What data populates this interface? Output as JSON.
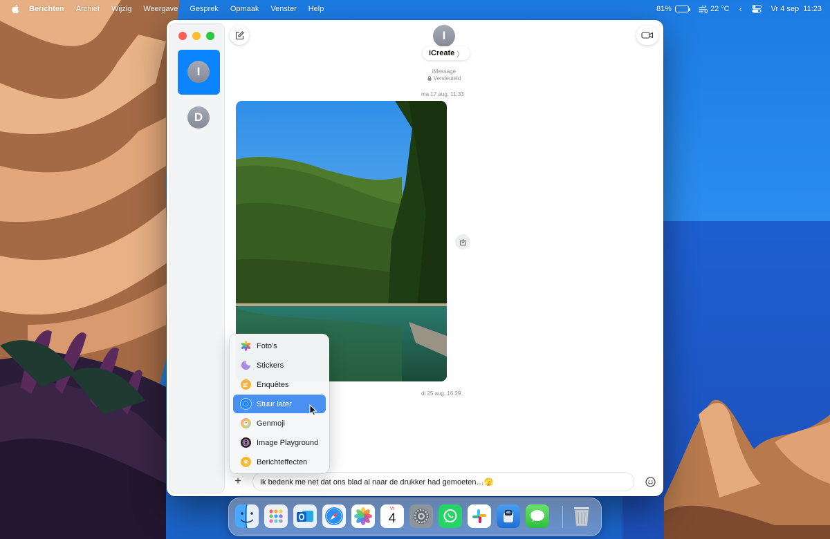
{
  "menubar": {
    "app_name": "Berichten",
    "menus": [
      "Archief",
      "Wijzig",
      "Weergave",
      "Gesprek",
      "Opmaak",
      "Venster",
      "Help"
    ],
    "battery_percent": "81%",
    "battery_level": 0.81,
    "temperature": "22 °C",
    "date_time": "Vr 4 sep  11:23"
  },
  "sidebar": {
    "conversations": [
      {
        "initial": "I",
        "selected": true
      },
      {
        "initial": "D",
        "selected": false
      }
    ]
  },
  "header": {
    "avatar_initial": "I",
    "contact_name": "iCreate",
    "chevron": "〉",
    "service": "iMessage",
    "encryption": "Versleuteld"
  },
  "messages": {
    "timestamp_1": "ma 17 aug, 11:33",
    "timestamp_2": "di 25 aug, 16:29"
  },
  "input": {
    "plus": "+",
    "text": "Ik bedenk me net dat ons blad al naar de drukker had gemoeten…🫣"
  },
  "popup_menu": {
    "items": [
      {
        "label": "Foto's",
        "icon": "photos-icon",
        "color": "#f2a23a",
        "selected": false
      },
      {
        "label": "Stickers",
        "icon": "stickers-icon",
        "color": "#a98ae8",
        "selected": false
      },
      {
        "label": "Enquêtes",
        "icon": "polls-icon",
        "color": "#f5b33e",
        "selected": false
      },
      {
        "label": "Stuur later",
        "icon": "send-later-icon",
        "color": "#1e88ff",
        "selected": true
      },
      {
        "label": "Genmoji",
        "icon": "genmoji-icon",
        "color": "#ef7ab0",
        "selected": false
      },
      {
        "label": "Image Playground",
        "icon": "image-playground-icon",
        "color": "#333333",
        "selected": false
      },
      {
        "label": "Berichteffecten",
        "icon": "message-effects-icon",
        "color": "#f7b731",
        "selected": false
      }
    ]
  },
  "dock": {
    "apps": [
      "finder",
      "launchpad",
      "outlook",
      "safari",
      "photos",
      "calendar",
      "system-settings",
      "whatsapp",
      "slack",
      "unknown-app",
      "messages",
      "trash"
    ],
    "calendar_day_label": "Vr",
    "calendar_date": "4"
  },
  "colors": {
    "accent": "#0a84ff",
    "menu_highlight": "#4a90f0"
  }
}
